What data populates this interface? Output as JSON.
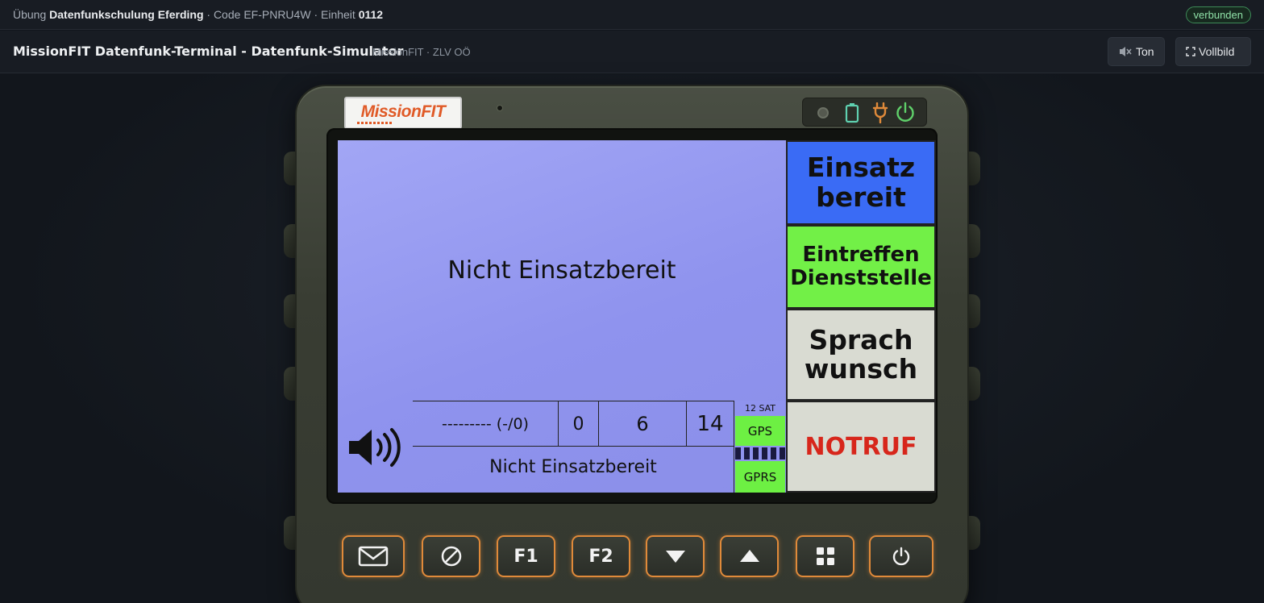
{
  "infobar": {
    "exercise_prefix": "Übung",
    "exercise_name": "Datenfunkschulung Eferding",
    "code_prefix": "· Code",
    "code": "EF-PNRU4W",
    "unit_prefix": "· Einheit",
    "unit": "0112",
    "connection_status": "verbunden"
  },
  "titlebar": {
    "title": "MissionFIT Datenfunk-Terminal - Datenfunk-Simulator",
    "subtitle": "MissionFIT · ZLV OÖ",
    "sound_button": "Ton",
    "sound_icon": "speaker-muted-icon",
    "fullscreen_button": "Vollbild",
    "fullscreen_icon": "fullscreen-icon"
  },
  "device": {
    "logo_text": "MissionFIT",
    "led_icons": [
      "camera-dot-icon",
      "battery-icon",
      "plug-icon",
      "power-icon"
    ],
    "led_colors": {
      "battery": "#5fd0b0",
      "plug": "#e08a3a",
      "power": "#5fd06a"
    }
  },
  "screen": {
    "status_main": "Nicht Einsatzbereit",
    "status_sub": "Nicht Einsatzbereit",
    "info": {
      "field1": "--------- (-/0)",
      "field2": "0",
      "field3": "6",
      "field4": "14"
    },
    "sat_count": "12 SAT",
    "gps_label": "GPS",
    "gprs_label": "GPRS",
    "speaker_icon": "speaker-loud-icon"
  },
  "status_buttons": [
    {
      "line1": "Einsatz",
      "line2": "bereit",
      "color": "#3a6bf5"
    },
    {
      "line1": "Eintreffen",
      "line2": "Dienststelle",
      "color": "#72f047"
    },
    {
      "line1": "Sprach",
      "line2": "wunsch",
      "color": "#d9dbd2"
    },
    {
      "line1": "NOTRUF",
      "line2": "",
      "color": "#d9dbd2",
      "text_color": "#d7261b"
    }
  ],
  "hardware_keys": [
    {
      "icon": "mail-icon",
      "label": ""
    },
    {
      "icon": "cancel-icon",
      "label": ""
    },
    {
      "icon": "",
      "label": "F1"
    },
    {
      "icon": "",
      "label": "F2"
    },
    {
      "icon": "arrow-down-icon",
      "label": ""
    },
    {
      "icon": "arrow-up-icon",
      "label": ""
    },
    {
      "icon": "grid-menu-icon",
      "label": ""
    },
    {
      "icon": "power-icon",
      "label": ""
    }
  ],
  "colors": {
    "accent_orange": "#e08a3a",
    "screen_bg": "#9296f0",
    "page_bg": "#12161c"
  }
}
